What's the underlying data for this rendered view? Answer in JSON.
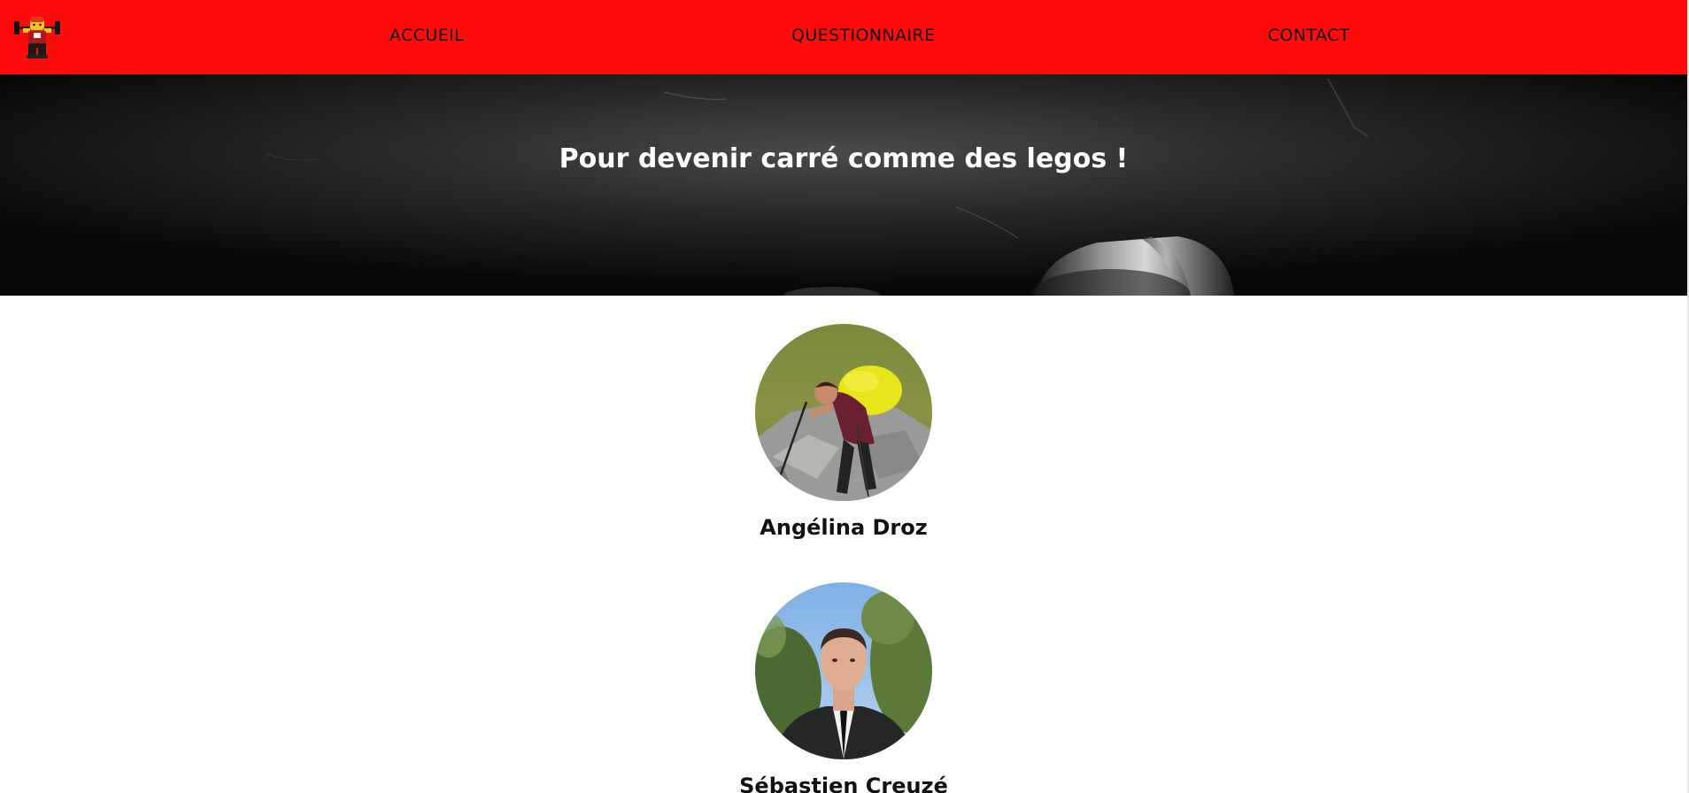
{
  "nav": {
    "logo_icon": "lego-weightlifter-logo",
    "links": [
      "ACCUEIL",
      "QUESTIONNAIRE",
      "CONTACT"
    ]
  },
  "hero": {
    "title": "Pour devenir carré comme des legos !"
  },
  "members": [
    {
      "name": "Angélina Droz",
      "photo": "hiker-with-yellow-backpack-photo"
    },
    {
      "name": "Sébastien Creuzé",
      "photo": "man-in-suit-photo"
    }
  ],
  "colors": {
    "navbar": "#fe0b0b",
    "hero_overlay": "#1a1a1a",
    "text_dark": "#111111",
    "text_light": "#ffffff"
  }
}
